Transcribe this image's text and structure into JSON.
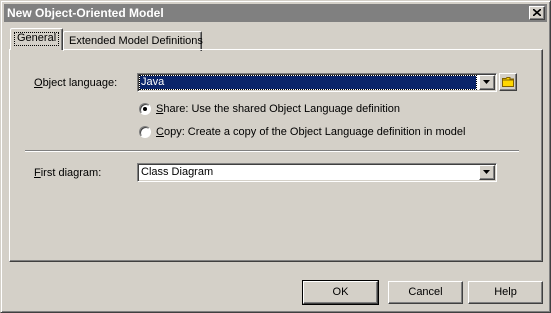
{
  "window": {
    "title": "New Object-Oriented Model"
  },
  "tabs": [
    {
      "label": "General",
      "active": true
    },
    {
      "label": "Extended Model Definitions",
      "active": false
    }
  ],
  "object_language": {
    "label_mnemonic": "O",
    "label_rest": "bject language:",
    "value": "Java"
  },
  "language_options": [
    {
      "mnemonic": "S",
      "rest": "hare: Use the shared Object Language definition",
      "selected": true
    },
    {
      "mnemonic": "C",
      "rest": "opy: Create a copy of the Object Language definition in model",
      "selected": false
    }
  ],
  "first_diagram": {
    "label_mnemonic": "F",
    "label_rest": "irst diagram:",
    "value": "Class Diagram"
  },
  "buttons": {
    "ok": "OK",
    "cancel": "Cancel",
    "help": "Help"
  },
  "icons": {
    "close": "close-icon",
    "dropdown": "chevron-down-icon",
    "folder": "folder-icon"
  },
  "colors": {
    "selection": "#0a246a",
    "titlebar": "#808080",
    "face": "#d4d0c8",
    "folder": "#ffd700"
  }
}
